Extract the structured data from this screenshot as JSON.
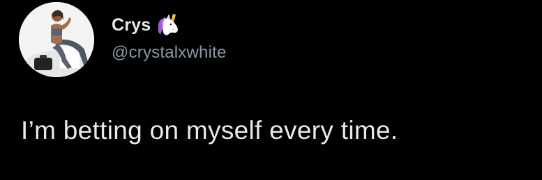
{
  "author": {
    "display_name": "Crys",
    "name_emoji": "unicorn-icon",
    "handle": "@crystalxwhite",
    "avatar_icon": "profile-photo"
  },
  "tweet": {
    "text": "I’m betting on myself every time."
  },
  "colors": {
    "background": "#000000",
    "name": "#e7e9ea",
    "handle": "#8b98a5",
    "text": "#e7e9ea"
  }
}
